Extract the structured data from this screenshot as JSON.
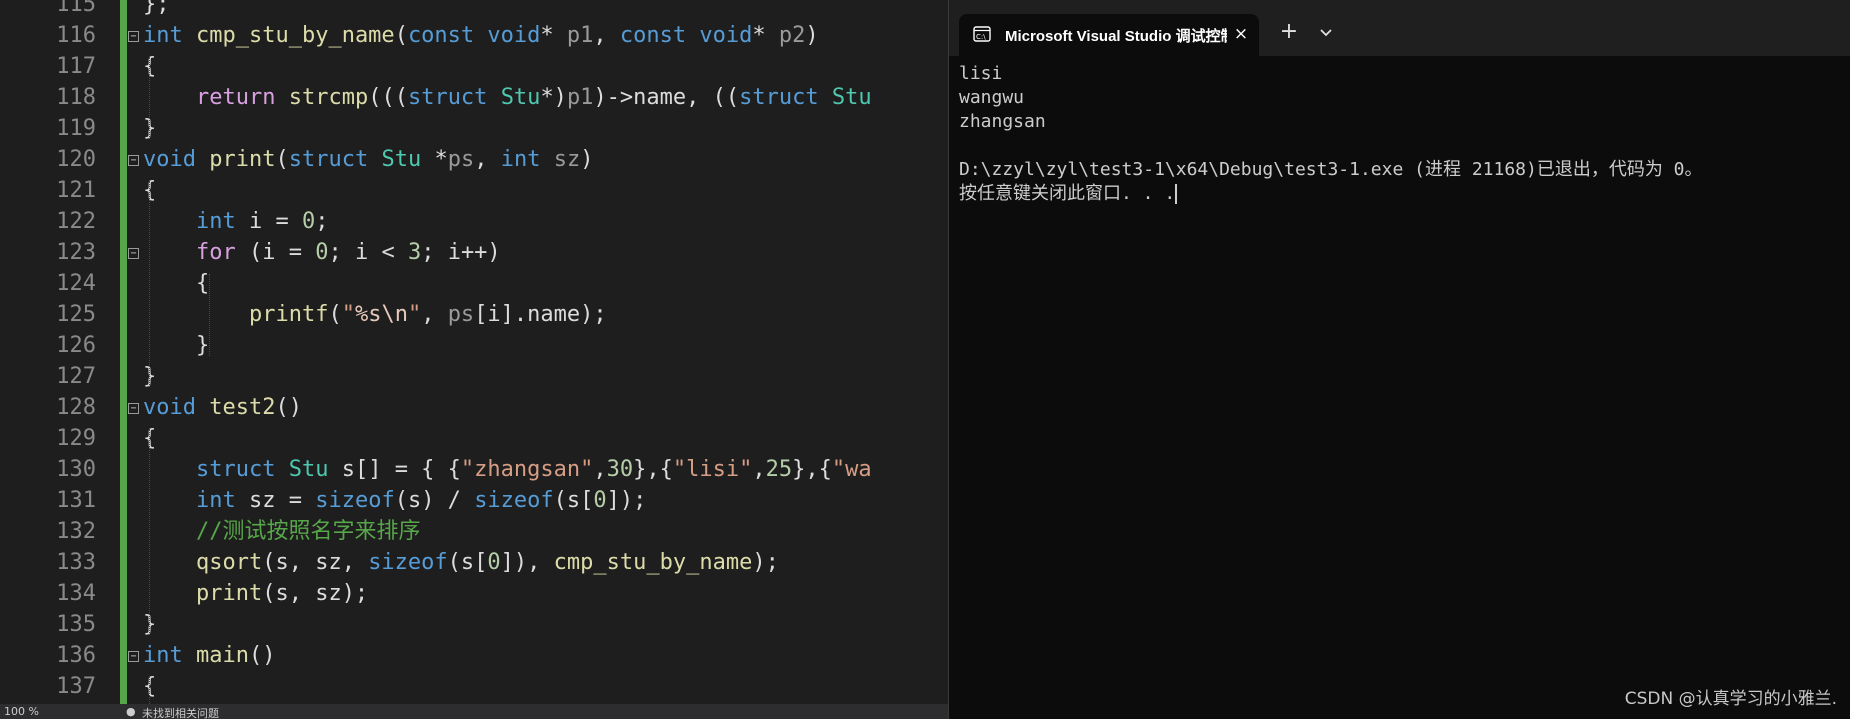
{
  "editor": {
    "lines": [
      {
        "num": "115",
        "tokens": [
          {
            "t": "}",
            "c": ""
          },
          {
            "t": ";",
            "c": ""
          }
        ]
      },
      {
        "num": "116",
        "tokens": [
          {
            "t": "int",
            "c": "kw"
          },
          {
            "t": " ",
            "c": ""
          },
          {
            "t": "cmp_stu_by_name",
            "c": "fn"
          },
          {
            "t": "(",
            "c": ""
          },
          {
            "t": "const",
            "c": "kw"
          },
          {
            "t": " ",
            "c": ""
          },
          {
            "t": "void",
            "c": "kw"
          },
          {
            "t": "* ",
            "c": ""
          },
          {
            "t": "p1",
            "c": "prm"
          },
          {
            "t": ", ",
            "c": ""
          },
          {
            "t": "const",
            "c": "kw"
          },
          {
            "t": " ",
            "c": ""
          },
          {
            "t": "void",
            "c": "kw"
          },
          {
            "t": "* ",
            "c": ""
          },
          {
            "t": "p2",
            "c": "prm"
          },
          {
            "t": ")",
            "c": ""
          }
        ]
      },
      {
        "num": "117",
        "tokens": [
          {
            "t": "{",
            "c": ""
          }
        ]
      },
      {
        "num": "118",
        "tokens": [
          {
            "t": "    ",
            "c": ""
          },
          {
            "t": "return",
            "c": "kw2"
          },
          {
            "t": " ",
            "c": ""
          },
          {
            "t": "strcmp",
            "c": "fn"
          },
          {
            "t": "(((",
            "c": ""
          },
          {
            "t": "struct",
            "c": "kw"
          },
          {
            "t": " ",
            "c": ""
          },
          {
            "t": "Stu",
            "c": "ty"
          },
          {
            "t": "*)",
            "c": ""
          },
          {
            "t": "p1",
            "c": "prm"
          },
          {
            "t": ")->name, ((",
            "c": ""
          },
          {
            "t": "struct",
            "c": "kw"
          },
          {
            "t": " ",
            "c": ""
          },
          {
            "t": "Stu",
            "c": "ty"
          }
        ]
      },
      {
        "num": "119",
        "tokens": [
          {
            "t": "}",
            "c": ""
          }
        ]
      },
      {
        "num": "120",
        "tokens": [
          {
            "t": "void",
            "c": "kw"
          },
          {
            "t": " ",
            "c": ""
          },
          {
            "t": "print",
            "c": "fn"
          },
          {
            "t": "(",
            "c": ""
          },
          {
            "t": "struct",
            "c": "kw"
          },
          {
            "t": " ",
            "c": ""
          },
          {
            "t": "Stu",
            "c": "ty"
          },
          {
            "t": " *",
            "c": ""
          },
          {
            "t": "ps",
            "c": "prm"
          },
          {
            "t": ", ",
            "c": ""
          },
          {
            "t": "int",
            "c": "kw"
          },
          {
            "t": " ",
            "c": ""
          },
          {
            "t": "sz",
            "c": "prm"
          },
          {
            "t": ")",
            "c": ""
          }
        ]
      },
      {
        "num": "121",
        "tokens": [
          {
            "t": "{",
            "c": ""
          }
        ]
      },
      {
        "num": "122",
        "tokens": [
          {
            "t": "    ",
            "c": ""
          },
          {
            "t": "int",
            "c": "kw"
          },
          {
            "t": " i = ",
            "c": ""
          },
          {
            "t": "0",
            "c": "num"
          },
          {
            "t": ";",
            "c": ""
          }
        ]
      },
      {
        "num": "123",
        "tokens": [
          {
            "t": "    ",
            "c": ""
          },
          {
            "t": "for",
            "c": "kw2"
          },
          {
            "t": " (i = ",
            "c": ""
          },
          {
            "t": "0",
            "c": "num"
          },
          {
            "t": "; i < ",
            "c": ""
          },
          {
            "t": "3",
            "c": "num"
          },
          {
            "t": "; i++)",
            "c": ""
          }
        ]
      },
      {
        "num": "124",
        "tokens": [
          {
            "t": "    {",
            "c": ""
          }
        ]
      },
      {
        "num": "125",
        "tokens": [
          {
            "t": "        ",
            "c": ""
          },
          {
            "t": "printf",
            "c": "fn"
          },
          {
            "t": "(",
            "c": ""
          },
          {
            "t": "\"",
            "c": "str"
          },
          {
            "t": "%s\\n",
            "c": "esc"
          },
          {
            "t": "\"",
            "c": "str"
          },
          {
            "t": ", ",
            "c": ""
          },
          {
            "t": "ps",
            "c": "prm"
          },
          {
            "t": "[i].name);",
            "c": ""
          }
        ]
      },
      {
        "num": "126",
        "tokens": [
          {
            "t": "    }",
            "c": ""
          }
        ]
      },
      {
        "num": "127",
        "tokens": [
          {
            "t": "}",
            "c": ""
          }
        ]
      },
      {
        "num": "128",
        "tokens": [
          {
            "t": "void",
            "c": "kw"
          },
          {
            "t": " ",
            "c": ""
          },
          {
            "t": "test2",
            "c": "fn"
          },
          {
            "t": "()",
            "c": ""
          }
        ]
      },
      {
        "num": "129",
        "tokens": [
          {
            "t": "{",
            "c": ""
          }
        ]
      },
      {
        "num": "130",
        "tokens": [
          {
            "t": "    ",
            "c": ""
          },
          {
            "t": "struct",
            "c": "kw"
          },
          {
            "t": " ",
            "c": ""
          },
          {
            "t": "Stu",
            "c": "ty"
          },
          {
            "t": " s[] = { {",
            "c": ""
          },
          {
            "t": "\"zhangsan\"",
            "c": "str"
          },
          {
            "t": ",",
            "c": ""
          },
          {
            "t": "30",
            "c": "num"
          },
          {
            "t": "},{",
            "c": ""
          },
          {
            "t": "\"lisi\"",
            "c": "str"
          },
          {
            "t": ",",
            "c": ""
          },
          {
            "t": "25",
            "c": "num"
          },
          {
            "t": "},{",
            "c": ""
          },
          {
            "t": "\"wa",
            "c": "str"
          }
        ]
      },
      {
        "num": "131",
        "tokens": [
          {
            "t": "    ",
            "c": ""
          },
          {
            "t": "int",
            "c": "kw"
          },
          {
            "t": " sz = ",
            "c": ""
          },
          {
            "t": "sizeof",
            "c": "kw"
          },
          {
            "t": "(s) / ",
            "c": ""
          },
          {
            "t": "sizeof",
            "c": "kw"
          },
          {
            "t": "(s[",
            "c": ""
          },
          {
            "t": "0",
            "c": "num"
          },
          {
            "t": "]);",
            "c": ""
          }
        ]
      },
      {
        "num": "132",
        "tokens": [
          {
            "t": "    ",
            "c": ""
          },
          {
            "t": "//测试按照名字来排序",
            "c": "cm"
          }
        ]
      },
      {
        "num": "133",
        "tokens": [
          {
            "t": "    ",
            "c": ""
          },
          {
            "t": "qsort",
            "c": "fn"
          },
          {
            "t": "(s, sz, ",
            "c": ""
          },
          {
            "t": "sizeof",
            "c": "kw"
          },
          {
            "t": "(s[",
            "c": ""
          },
          {
            "t": "0",
            "c": "num"
          },
          {
            "t": "]), ",
            "c": ""
          },
          {
            "t": "cmp_stu_by_name",
            "c": "fn"
          },
          {
            "t": ");",
            "c": ""
          }
        ]
      },
      {
        "num": "134",
        "tokens": [
          {
            "t": "    ",
            "c": ""
          },
          {
            "t": "print",
            "c": "fn"
          },
          {
            "t": "(s, sz);",
            "c": ""
          }
        ]
      },
      {
        "num": "135",
        "tokens": [
          {
            "t": "}",
            "c": ""
          }
        ]
      },
      {
        "num": "136",
        "tokens": [
          {
            "t": "int",
            "c": "kw"
          },
          {
            "t": " ",
            "c": ""
          },
          {
            "t": "main",
            "c": "fn"
          },
          {
            "t": "()",
            "c": ""
          }
        ]
      },
      {
        "num": "137",
        "tokens": [
          {
            "t": "{",
            "c": ""
          }
        ]
      }
    ],
    "status": {
      "zoom": "100 %",
      "issues": "未找到相关问题"
    }
  },
  "terminal": {
    "tab_title": "Microsoft Visual Studio 调试控制台",
    "new_tab_label": "+",
    "close_label": "×",
    "output": [
      "lisi",
      "wangwu",
      "zhangsan",
      "",
      "D:\\zzyl\\zyl\\test3-1\\x64\\Debug\\test3-1.exe (进程 21168)已退出，代码为 0。",
      "按任意键关闭此窗口. . ."
    ]
  },
  "watermark": "CSDN @认真学习的小雅兰."
}
